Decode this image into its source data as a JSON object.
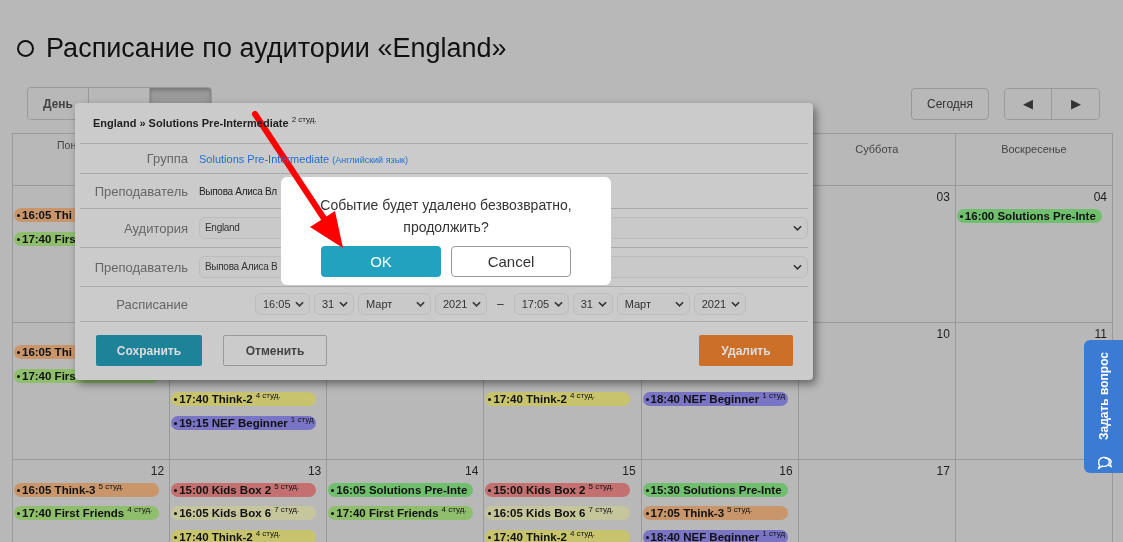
{
  "page": {
    "title": "Расписание по аудитории «England»"
  },
  "view_tabs": [
    {
      "label": "День",
      "selected": false
    },
    {
      "selected": false
    },
    {
      "selected": true
    }
  ],
  "today_button": "Сегодня",
  "nav": [
    "◀",
    "▶"
  ],
  "calendar": {
    "weekdays": {
      "column_1": "Пон",
      "column_6": "Суббота",
      "column_7": "Воскресенье"
    },
    "weeks": [
      {
        "column_1": {
          "events": [
            {
              "title": "16:05 Thi",
              "color": "#c8966a"
            },
            {
              "title": "17:40 Firs",
              "color": "#8fbf6c"
            }
          ]
        },
        "column_6": {
          "day": "03"
        },
        "column_7": {
          "day": "04",
          "events": [
            {
              "title": "16:00 Solutions Pre-Inte",
              "color": "#6fbf6f"
            }
          ]
        }
      },
      {
        "column_1": {
          "events": [
            {
              "title": "16:05 Thi",
              "color": "#c8966a"
            },
            {
              "title": "17:40 Firs",
              "color": "#8fbf6c"
            }
          ]
        },
        "column_2": {
          "events": [
            {
              "title": "17:40 Think-2",
              "count": "4 студ.",
              "color": "#c8c46e"
            },
            {
              "title": "19:15 NEF Beginner",
              "count": "1 студ",
              "color": "#7a74c4"
            }
          ]
        },
        "column_4": {
          "events": [
            {
              "title": "17:40 Think-2",
              "count": "4 студ.",
              "color": "#c8c46e"
            }
          ]
        },
        "column_5": {
          "events": [
            {
              "title": "18:40 NEF Beginner",
              "count": "1 студ",
              "color": "#7a74c4"
            }
          ]
        },
        "column_6": {
          "day": "10"
        },
        "column_7": {
          "day": "11"
        }
      },
      {
        "column_1": {
          "day": "12",
          "events": [
            {
              "title": "16:05 Think-3",
              "count": "5 студ.",
              "color": "#c8966a"
            },
            {
              "title": "17:40 First Friends",
              "count": "4 студ.",
              "color": "#8fbf6c"
            }
          ]
        },
        "column_2": {
          "day": "13",
          "events": [
            {
              "title": "15:00 Kids Box 2",
              "count": "5 студ.",
              "color": "#c47070"
            },
            {
              "title": "16:05 Kids Box 6",
              "count": "7 студ.",
              "color": "#c6c69c"
            },
            {
              "title": "17:40 Think-2",
              "count": "4 студ.",
              "color": "#c8c46e"
            }
          ]
        },
        "column_3": {
          "day": "14",
          "events": [
            {
              "title": "16:05 Solutions Pre-Inte",
              "color": "#6fbf6f"
            },
            {
              "title": "17:40 First Friends",
              "count": "4 студ.",
              "color": "#8fbf6c"
            }
          ]
        },
        "column_4": {
          "day": "15",
          "events": [
            {
              "title": "15:00 Kids Box 2",
              "count": "5 студ.",
              "color": "#c47070"
            },
            {
              "title": "16:05 Kids Box 6",
              "count": "7 студ.",
              "color": "#c6c69c"
            },
            {
              "title": "17:40 Think-2",
              "count": "4 студ.",
              "color": "#c8c46e"
            }
          ]
        },
        "column_5": {
          "day": "16",
          "events": [
            {
              "title": "15:30 Solutions Pre-Inte",
              "color": "#6fbf6f"
            },
            {
              "title": "17:05 Think-3",
              "count": "5 студ.",
              "color": "#c8966a"
            },
            {
              "title": "18:40 NEF Beginner",
              "count": "1 студ",
              "color": "#7a74c4"
            }
          ]
        },
        "column_6": {
          "day": "17"
        }
      }
    ]
  },
  "event_dialog": {
    "title": "England » Solutions Pre-Intermediate $^{2 студ.}$",
    "rows": [
      {
        "kind": "link",
        "label": "Группа",
        "value": "Solutions Pre-Intermediate",
        "note": "(Английский язык)"
      },
      {
        "kind": "text",
        "label": "Преподаватель",
        "value": "Выпова Алиса Вл"
      },
      {
        "kind": "select",
        "label": "Аудитория",
        "value": "England"
      },
      {
        "kind": "select",
        "label": "Преподаватель",
        "value": "Выпова Алиса В"
      },
      {
        "kind": "schedule",
        "label": "Расписание",
        "start": [
          "16:05",
          "31",
          "Март",
          "2021"
        ],
        "separator": "–",
        "end": [
          "17:05",
          "31",
          "Март",
          "2021"
        ]
      }
    ],
    "buttons": {
      "save": "Сохранить",
      "cancel": "Отменить",
      "delete": "Удалить"
    }
  },
  "confirm_dialog": {
    "message": "Событие будет удалено безвозвратно, продолжить?",
    "ok": "OK",
    "cancel": "Cancel"
  },
  "feedback_tab": {
    "label": "Задать вопрос"
  }
}
